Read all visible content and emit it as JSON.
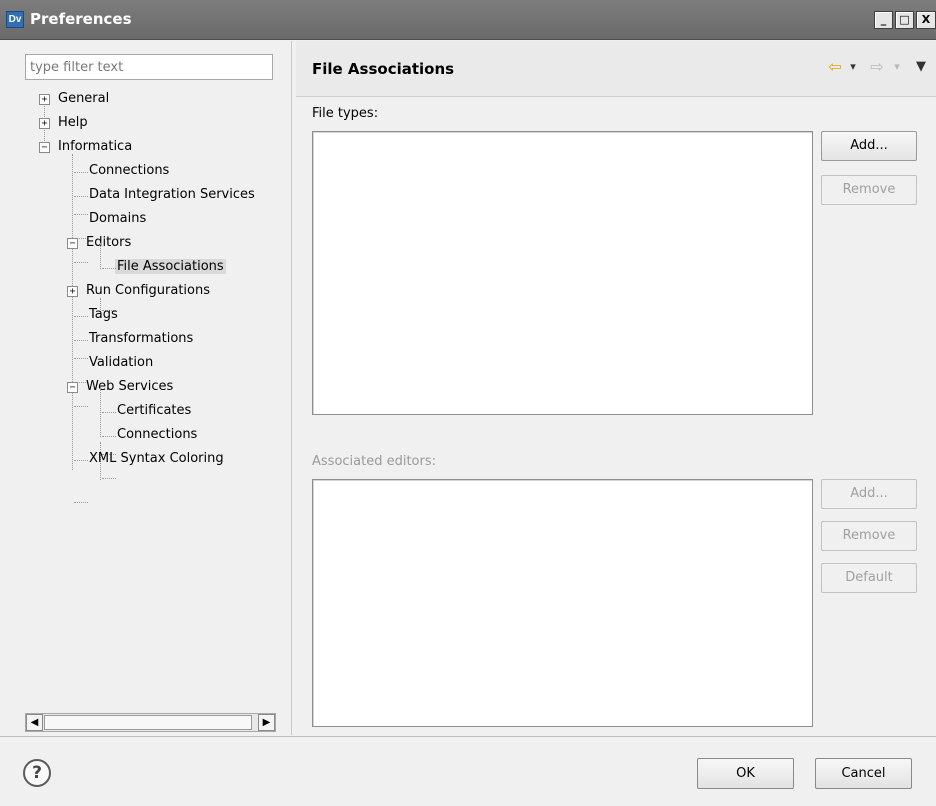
{
  "window": {
    "title": "Preferences",
    "app_icon_text": "Dv",
    "minimize_glyph": "_",
    "maximize_glyph": "□",
    "close_glyph": "X"
  },
  "filter": {
    "placeholder": "type filter text",
    "value": ""
  },
  "tree": {
    "items": [
      {
        "label": "General",
        "expander": "+"
      },
      {
        "label": "Help",
        "expander": "+"
      },
      {
        "label": "Informatica",
        "expander": "−"
      },
      {
        "label": "Connections"
      },
      {
        "label": "Data Integration Services"
      },
      {
        "label": "Domains"
      },
      {
        "label": "Editors",
        "expander": "−"
      },
      {
        "label": "File Associations",
        "selected": true
      },
      {
        "label": "Run Configurations",
        "expander": "+"
      },
      {
        "label": "Tags"
      },
      {
        "label": "Transformations"
      },
      {
        "label": "Validation"
      },
      {
        "label": "Web Services",
        "expander": "−"
      },
      {
        "label": "Certificates"
      },
      {
        "label": "Connections"
      },
      {
        "label": "XML Syntax Coloring"
      }
    ]
  },
  "scrollbar": {
    "left_glyph": "◀",
    "right_glyph": "▶"
  },
  "page": {
    "title": "File Associations",
    "back_icon": "⇦",
    "forward_icon": "⇨",
    "dropdown_glyph": "▾",
    "menu_glyph": "▼",
    "back_color": "#e8a400"
  },
  "file_types": {
    "label": "File types:",
    "add_label": "Add...",
    "remove_label": "Remove"
  },
  "editors": {
    "label": "Associated editors:",
    "add_label": "Add...",
    "remove_label": "Remove",
    "default_label": "Default"
  },
  "footer": {
    "help_glyph": "?",
    "ok_label": "OK",
    "cancel_label": "Cancel"
  }
}
